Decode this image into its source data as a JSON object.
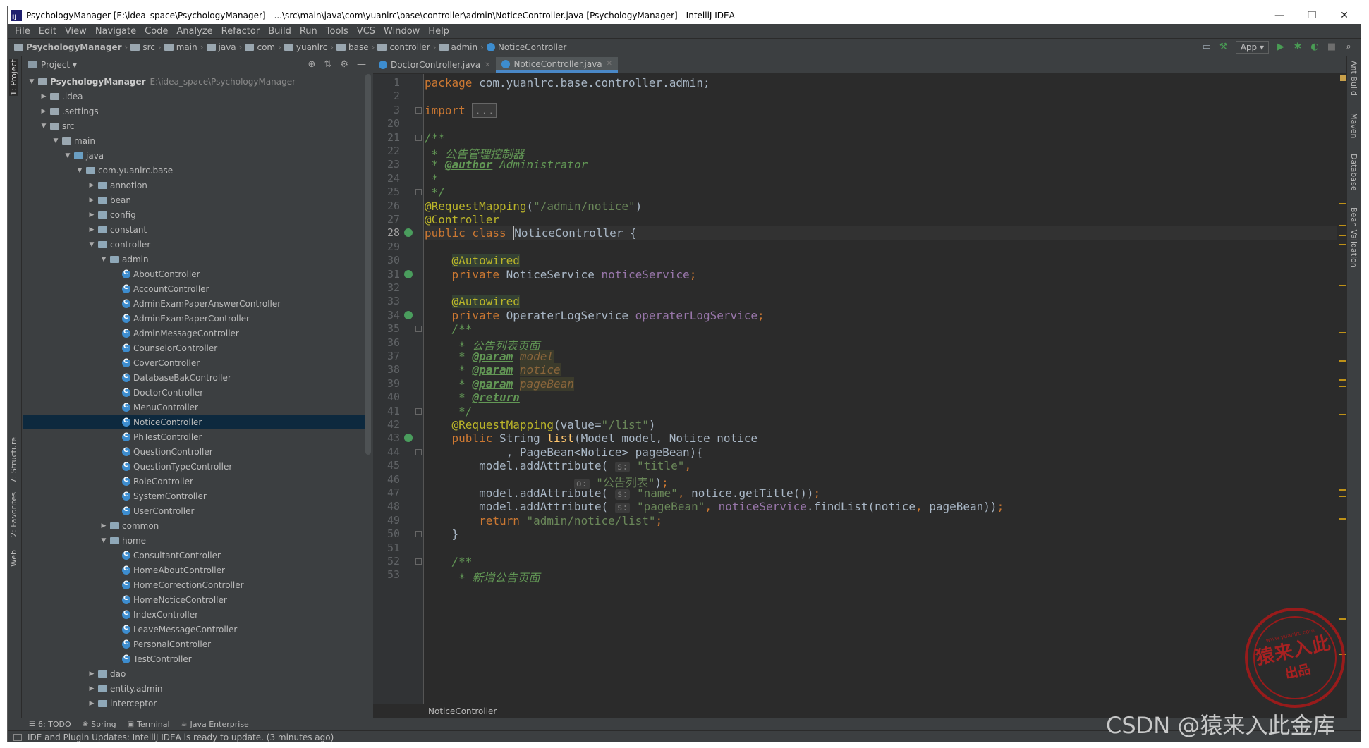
{
  "window": {
    "title": "PsychologyManager [E:\\idea_space\\PsychologyManager] - ...\\src\\main\\java\\com\\yuanlrc\\base\\controller\\admin\\NoticeController.java [PsychologyManager] - IntelliJ IDEA",
    "logo_text": "IJ",
    "minimize": "—",
    "maximize": "❐",
    "close": "✕"
  },
  "menu": [
    "File",
    "Edit",
    "View",
    "Navigate",
    "Code",
    "Analyze",
    "Refactor",
    "Build",
    "Run",
    "Tools",
    "VCS",
    "Window",
    "Help"
  ],
  "navbar": {
    "crumbs": [
      "PsychologyManager",
      "src",
      "main",
      "java",
      "com",
      "yuanlrc",
      "base",
      "controller",
      "admin",
      "NoticeController"
    ],
    "run_config": "App ▾"
  },
  "project_panel": {
    "title": "Project ▾",
    "tree": [
      {
        "depth": 0,
        "arrow": "▼",
        "icon": "folder",
        "label": "PsychologyManager",
        "path": "E:\\idea_space\\PsychologyManager",
        "bold": true
      },
      {
        "depth": 1,
        "arrow": "▶",
        "icon": "folder",
        "label": ".idea"
      },
      {
        "depth": 1,
        "arrow": "▶",
        "icon": "folder",
        "label": ".settings"
      },
      {
        "depth": 1,
        "arrow": "▼",
        "icon": "folder",
        "label": "src"
      },
      {
        "depth": 2,
        "arrow": "▼",
        "icon": "folder",
        "label": "main"
      },
      {
        "depth": 3,
        "arrow": "▼",
        "icon": "src",
        "label": "java"
      },
      {
        "depth": 4,
        "arrow": "▼",
        "icon": "pkg",
        "label": "com.yuanlrc.base"
      },
      {
        "depth": 5,
        "arrow": "▶",
        "icon": "pkg",
        "label": "annotion"
      },
      {
        "depth": 5,
        "arrow": "▶",
        "icon": "pkg",
        "label": "bean"
      },
      {
        "depth": 5,
        "arrow": "▶",
        "icon": "pkg",
        "label": "config"
      },
      {
        "depth": 5,
        "arrow": "▶",
        "icon": "pkg",
        "label": "constant"
      },
      {
        "depth": 5,
        "arrow": "▼",
        "icon": "pkg",
        "label": "controller"
      },
      {
        "depth": 6,
        "arrow": "▼",
        "icon": "pkg",
        "label": "admin"
      },
      {
        "depth": 7,
        "arrow": "",
        "icon": "class",
        "label": "AboutController"
      },
      {
        "depth": 7,
        "arrow": "",
        "icon": "class",
        "label": "AccountController"
      },
      {
        "depth": 7,
        "arrow": "",
        "icon": "class",
        "label": "AdminExamPaperAnswerController"
      },
      {
        "depth": 7,
        "arrow": "",
        "icon": "class",
        "label": "AdminExamPaperController"
      },
      {
        "depth": 7,
        "arrow": "",
        "icon": "class",
        "label": "AdminMessageController"
      },
      {
        "depth": 7,
        "arrow": "",
        "icon": "class",
        "label": "CounselorController"
      },
      {
        "depth": 7,
        "arrow": "",
        "icon": "class",
        "label": "CoverController"
      },
      {
        "depth": 7,
        "arrow": "",
        "icon": "class",
        "label": "DatabaseBakController"
      },
      {
        "depth": 7,
        "arrow": "",
        "icon": "class",
        "label": "DoctorController"
      },
      {
        "depth": 7,
        "arrow": "",
        "icon": "class",
        "label": "MenuController"
      },
      {
        "depth": 7,
        "arrow": "",
        "icon": "class",
        "label": "NoticeController",
        "selected": true
      },
      {
        "depth": 7,
        "arrow": "",
        "icon": "class",
        "label": "PhTestController"
      },
      {
        "depth": 7,
        "arrow": "",
        "icon": "class",
        "label": "QuestionController"
      },
      {
        "depth": 7,
        "arrow": "",
        "icon": "class",
        "label": "QuestionTypeController"
      },
      {
        "depth": 7,
        "arrow": "",
        "icon": "class",
        "label": "RoleController"
      },
      {
        "depth": 7,
        "arrow": "",
        "icon": "class",
        "label": "SystemController"
      },
      {
        "depth": 7,
        "arrow": "",
        "icon": "class",
        "label": "UserController"
      },
      {
        "depth": 6,
        "arrow": "▶",
        "icon": "pkg",
        "label": "common"
      },
      {
        "depth": 6,
        "arrow": "▼",
        "icon": "pkg",
        "label": "home"
      },
      {
        "depth": 7,
        "arrow": "",
        "icon": "class",
        "label": "ConsultantController"
      },
      {
        "depth": 7,
        "arrow": "",
        "icon": "class",
        "label": "HomeAboutController"
      },
      {
        "depth": 7,
        "arrow": "",
        "icon": "class",
        "label": "HomeCorrectionController"
      },
      {
        "depth": 7,
        "arrow": "",
        "icon": "class",
        "label": "HomeNoticeController"
      },
      {
        "depth": 7,
        "arrow": "",
        "icon": "class",
        "label": "IndexController"
      },
      {
        "depth": 7,
        "arrow": "",
        "icon": "class",
        "label": "LeaveMessageController"
      },
      {
        "depth": 7,
        "arrow": "",
        "icon": "class",
        "label": "PersonalController"
      },
      {
        "depth": 7,
        "arrow": "",
        "icon": "class",
        "label": "TestController"
      },
      {
        "depth": 5,
        "arrow": "▶",
        "icon": "pkg",
        "label": "dao"
      },
      {
        "depth": 5,
        "arrow": "▶",
        "icon": "pkg",
        "label": "entity.admin"
      },
      {
        "depth": 5,
        "arrow": "▶",
        "icon": "pkg",
        "label": "interceptor"
      }
    ]
  },
  "editor": {
    "tabs": [
      {
        "label": "DoctorController.java",
        "active": false
      },
      {
        "label": "NoticeController.java",
        "active": true
      }
    ],
    "breadcrumb": "NoticeController",
    "lines": [
      {
        "n": "1",
        "tokens": [
          [
            "kw",
            "package "
          ],
          [
            "",
            "com.yuanlrc.base.controller.admin;"
          ]
        ]
      },
      {
        "n": "2",
        "tokens": []
      },
      {
        "n": "3",
        "tokens": [
          [
            "kw",
            "import "
          ],
          [
            "fold",
            "..."
          ]
        ]
      },
      {
        "n": "20",
        "tokens": []
      },
      {
        "n": "21",
        "tokens": [
          [
            "cmt",
            "/**"
          ]
        ]
      },
      {
        "n": "22",
        "tokens": [
          [
            "cmt",
            " * 公告管理控制器"
          ]
        ]
      },
      {
        "n": "23",
        "tokens": [
          [
            "cmt",
            " * "
          ],
          [
            "tag",
            "@author"
          ],
          [
            "cmt",
            " Administrator"
          ]
        ]
      },
      {
        "n": "24",
        "tokens": [
          [
            "cmt",
            " *"
          ]
        ]
      },
      {
        "n": "25",
        "tokens": [
          [
            "cmt",
            " */"
          ]
        ]
      },
      {
        "n": "26",
        "tokens": [
          [
            "ann",
            "@RequestMapping"
          ],
          [
            "",
            "("
          ],
          [
            "str",
            "\"/admin/notice\""
          ],
          [
            "",
            ")"
          ]
        ]
      },
      {
        "n": "27",
        "tokens": [
          [
            "ann",
            "@Controller"
          ]
        ]
      },
      {
        "n": "28",
        "tokens": [
          [
            "kw",
            "public class "
          ],
          [
            "caret",
            ""
          ],
          [
            "",
            "NoticeController {"
          ]
        ],
        "current": true
      },
      {
        "n": "29",
        "tokens": []
      },
      {
        "n": "30",
        "tokens": [
          [
            "",
            "    "
          ],
          [
            "annhl",
            "@Autowired"
          ]
        ]
      },
      {
        "n": "31",
        "tokens": [
          [
            "",
            "    "
          ],
          [
            "kw",
            "private "
          ],
          [
            "",
            "NoticeService "
          ],
          [
            "fld",
            "noticeService"
          ],
          [
            "kw",
            ";"
          ]
        ]
      },
      {
        "n": "32",
        "tokens": []
      },
      {
        "n": "33",
        "tokens": [
          [
            "",
            "    "
          ],
          [
            "annhl",
            "@Autowired"
          ]
        ]
      },
      {
        "n": "34",
        "tokens": [
          [
            "",
            "    "
          ],
          [
            "kw",
            "private "
          ],
          [
            "",
            "OperaterLogService "
          ],
          [
            "fld",
            "operaterLogService"
          ],
          [
            "kw",
            ";"
          ]
        ]
      },
      {
        "n": "35",
        "tokens": [
          [
            "cmt",
            "    /**"
          ]
        ]
      },
      {
        "n": "36",
        "tokens": [
          [
            "cmt",
            "     * 公告列表页面"
          ]
        ]
      },
      {
        "n": "37",
        "tokens": [
          [
            "cmt",
            "     * "
          ],
          [
            "tag",
            "@param"
          ],
          [
            "cmt",
            " "
          ],
          [
            "par",
            "model"
          ]
        ]
      },
      {
        "n": "38",
        "tokens": [
          [
            "cmt",
            "     * "
          ],
          [
            "tag",
            "@param"
          ],
          [
            "cmt",
            " "
          ],
          [
            "par",
            "notice"
          ]
        ]
      },
      {
        "n": "39",
        "tokens": [
          [
            "cmt",
            "     * "
          ],
          [
            "tag",
            "@param"
          ],
          [
            "cmt",
            " "
          ],
          [
            "par",
            "pageBean"
          ]
        ]
      },
      {
        "n": "40",
        "tokens": [
          [
            "cmt",
            "     * "
          ],
          [
            "tag",
            "@return"
          ]
        ]
      },
      {
        "n": "41",
        "tokens": [
          [
            "cmt",
            "     */"
          ]
        ]
      },
      {
        "n": "42",
        "tokens": [
          [
            "",
            "    "
          ],
          [
            "ann",
            "@RequestMapping"
          ],
          [
            "",
            "(value="
          ],
          [
            "str",
            "\"/list\""
          ],
          [
            "",
            ")"
          ]
        ]
      },
      {
        "n": "43",
        "tokens": [
          [
            "",
            "    "
          ],
          [
            "kw",
            "public "
          ],
          [
            "",
            "String "
          ],
          [
            "mth",
            "list"
          ],
          [
            "",
            "(Model model, Notice notice"
          ]
        ]
      },
      {
        "n": "44",
        "tokens": [
          [
            "",
            "            , PageBean<Notice> pageBean){"
          ]
        ]
      },
      {
        "n": "45",
        "tokens": [
          [
            "",
            "        model.addAttribute( "
          ],
          [
            "hint",
            "s:"
          ],
          [
            "str",
            " \"title\""
          ],
          [
            "kw",
            ","
          ]
        ]
      },
      {
        "n": "46",
        "tokens": [
          [
            "",
            "                      "
          ],
          [
            "hint",
            "o:"
          ],
          [
            "str",
            " \"公告列表\""
          ],
          [
            "",
            ")"
          ],
          [
            "kw",
            ";"
          ]
        ]
      },
      {
        "n": "47",
        "tokens": [
          [
            "",
            "        model.addAttribute( "
          ],
          [
            "hint",
            "s:"
          ],
          [
            "str",
            " \"name\""
          ],
          [
            "kw",
            ", "
          ],
          [
            "",
            "notice.getTitle())"
          ],
          [
            "kw",
            ";"
          ]
        ]
      },
      {
        "n": "48",
        "tokens": [
          [
            "",
            "        model.addAttribute( "
          ],
          [
            "hint",
            "s:"
          ],
          [
            "str",
            " \"pageBean\""
          ],
          [
            "kw",
            ", "
          ],
          [
            "fld",
            "noticeService"
          ],
          [
            "",
            ".findList(notice"
          ],
          [
            "kw",
            ", "
          ],
          [
            "",
            "pageBean))"
          ],
          [
            "kw",
            ";"
          ]
        ]
      },
      {
        "n": "49",
        "tokens": [
          [
            "",
            "        "
          ],
          [
            "kw",
            "return "
          ],
          [
            "str",
            "\"admin/notice/list\""
          ],
          [
            "kw",
            ";"
          ]
        ]
      },
      {
        "n": "50",
        "tokens": [
          [
            "",
            "    }"
          ]
        ]
      },
      {
        "n": "51",
        "tokens": []
      },
      {
        "n": "52",
        "tokens": [
          [
            "cmt",
            "    /**"
          ]
        ]
      },
      {
        "n": "53",
        "tokens": [
          [
            "cmt",
            "     * 新增公告页面"
          ]
        ]
      }
    ]
  },
  "left_tools": [
    "1: Project",
    "7: Structure",
    "2: Favorites",
    "Web"
  ],
  "right_tools": [
    "Ant Build",
    "Maven",
    "Database",
    "Bean Validation"
  ],
  "bottom_tools": [
    {
      "icon": "☰",
      "label": "6: TODO"
    },
    {
      "icon": "❀",
      "label": "Spring"
    },
    {
      "icon": "▣",
      "label": "Terminal"
    },
    {
      "icon": "☕",
      "label": "Java Enterprise"
    }
  ],
  "status": "IDE and Plugin Updates: IntelliJ IDEA is ready to update. (3 minutes ago)",
  "watermarks": {
    "stamp_main": "猿来入此",
    "stamp_sub": "出品",
    "stamp_url": "www.yuanlrc.com",
    "csdn": "CSDN @猿来入此金库"
  }
}
